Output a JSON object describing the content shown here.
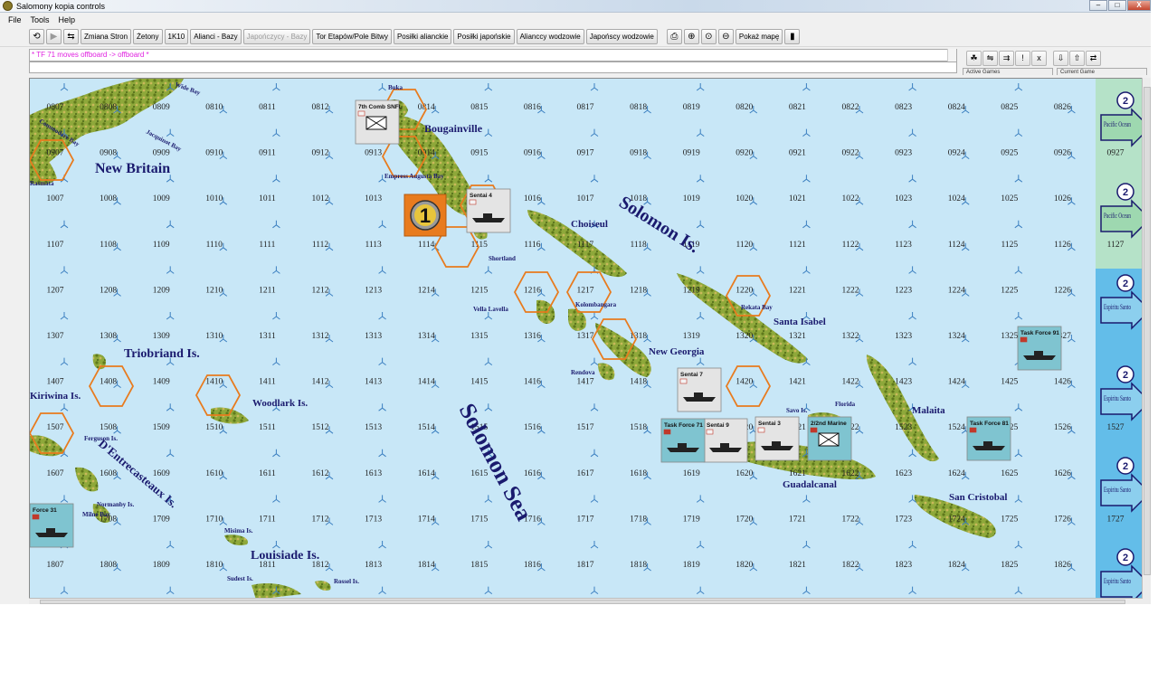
{
  "window": {
    "title": "Salomony kopia controls",
    "minimize": "–",
    "maximize": "□",
    "close": "X"
  },
  "menu": [
    "File",
    "Tools",
    "Help"
  ],
  "toolbar": {
    "buttons": [
      "Zmiana Stron",
      "Żetony",
      "1K10",
      "Alianci - Bazy",
      "Japończycy - Bazy",
      "Tor Etapów/Pole Bitwy",
      "Posiłki alianckie",
      "Posiłki japońskie",
      "Alianccy wodzowie",
      "Japońscy wodzowie"
    ],
    "zoom_label": "Pokaż mapę"
  },
  "chat": {
    "log": "* TF 71 moves offboard -> offboard *"
  },
  "side_tabs": [
    "Active Games",
    "Current Game"
  ],
  "colors": {
    "sea": "#c8e7f7",
    "land": "#8ea83a",
    "hex_outline": "#e87b1e",
    "label": "#1a1a6e"
  },
  "map": {
    "hex_rows": [
      {
        "row": "08",
        "cols": [
          "0807",
          "0808",
          "0809",
          "0810",
          "0811",
          "0812",
          "0813",
          "0814",
          "0815",
          "0816",
          "0817",
          "0818",
          "0819",
          "0820",
          "0821",
          "0822",
          "0823",
          "0824",
          "0825",
          "0826"
        ]
      },
      {
        "row": "09",
        "cols": [
          "0907",
          "0908",
          "0909",
          "0910",
          "0911",
          "0912",
          "0913",
          "0914",
          "0915",
          "0916",
          "0917",
          "0918",
          "0919",
          "0920",
          "0921",
          "0922",
          "0923",
          "0924",
          "0925",
          "0926",
          "0927"
        ]
      },
      {
        "row": "10",
        "cols": [
          "1007",
          "1008",
          "1009",
          "1010",
          "1011",
          "1012",
          "1013",
          "1014",
          "1015",
          "1016",
          "1017",
          "1018",
          "1019",
          "1020",
          "1021",
          "1022",
          "1023",
          "1024",
          "1025",
          "1026"
        ]
      },
      {
        "row": "11",
        "cols": [
          "1107",
          "1108",
          "1109",
          "1110",
          "1111",
          "1112",
          "1113",
          "1114",
          "1115",
          "1116",
          "1117",
          "1118",
          "1119",
          "1120",
          "1121",
          "1122",
          "1123",
          "1124",
          "1125",
          "1126",
          "1127"
        ]
      },
      {
        "row": "12",
        "cols": [
          "1207",
          "1208",
          "1209",
          "1210",
          "1211",
          "1212",
          "1213",
          "1214",
          "1215",
          "1216",
          "1217",
          "1218",
          "1219",
          "1220",
          "1221",
          "1222",
          "1223",
          "1224",
          "1225",
          "1226"
        ]
      },
      {
        "row": "13",
        "cols": [
          "1307",
          "1308",
          "1309",
          "1310",
          "1311",
          "1312",
          "1313",
          "1314",
          "1315",
          "1316",
          "1317",
          "1318",
          "1319",
          "1320",
          "1321",
          "1322",
          "1323",
          "1324",
          "1325",
          "1327"
        ]
      },
      {
        "row": "14",
        "cols": [
          "1407",
          "1408",
          "1409",
          "1410",
          "1411",
          "1412",
          "1413",
          "1414",
          "1415",
          "1416",
          "1417",
          "1418",
          "1419",
          "1420",
          "1421",
          "1422",
          "1423",
          "1424",
          "1425",
          "1426"
        ]
      },
      {
        "row": "15",
        "cols": [
          "1507",
          "1508",
          "1509",
          "1510",
          "1511",
          "1512",
          "1513",
          "1514",
          "1515",
          "1516",
          "1517",
          "1518",
          "1519",
          "1520",
          "1521",
          "1522",
          "1523",
          "1524",
          "1525",
          "1526",
          "1527"
        ]
      },
      {
        "row": "16",
        "cols": [
          "1607",
          "1608",
          "1609",
          "1610",
          "1611",
          "1612",
          "1613",
          "1614",
          "1615",
          "1616",
          "1617",
          "1618",
          "1619",
          "1620",
          "1621",
          "1622",
          "1623",
          "1624",
          "1625",
          "1626"
        ]
      },
      {
        "row": "17",
        "cols": [
          "1707",
          "1708",
          "1709",
          "1710",
          "1711",
          "1712",
          "1713",
          "1714",
          "1715",
          "1716",
          "1717",
          "1718",
          "1719",
          "1720",
          "1721",
          "1722",
          "1723",
          "1724",
          "1725",
          "1726",
          "1727"
        ]
      },
      {
        "row": "18",
        "cols": [
          "1807",
          "1808",
          "1809",
          "1810",
          "1811",
          "1812",
          "1813",
          "1814",
          "1815",
          "1816",
          "1817",
          "1818",
          "1819",
          "1820",
          "1821",
          "1822",
          "1823",
          "1824",
          "1825",
          "1826"
        ]
      }
    ],
    "big_labels": [
      "New Britain",
      "Bougainville",
      "Choiseul",
      "Solomon Is.",
      "Santa Isabel",
      "New Georgia",
      "Triobriand Is.",
      "Woodlark Is.",
      "Kiriwina Is.",
      "D'Entrecasteaux Is.",
      "Louisiade Is.",
      "Solomon Sea",
      "Guadalcanal",
      "Malaita",
      "San Cristobal"
    ],
    "small_labels": [
      "Commodore Bay",
      "Wide Bay",
      "Jacquinot Bay",
      "Buka",
      "Empress Augusta Bay",
      "Shortland",
      "Vella Lavella",
      "Kolombangara",
      "Rendova",
      "Rekata Bay",
      "Savo Is.",
      "Florida",
      "Ferguson Is.",
      "Normanby Is.",
      "Milne Bay",
      "Misima Is.",
      "Sudest Is.",
      "Rossel Is.",
      "Rasmata"
    ],
    "units": [
      {
        "name": "7th Comb SNFL",
        "side": "japanese"
      },
      {
        "name": "Sentai 4",
        "side": "japanese"
      },
      {
        "name": "Sentai 7",
        "side": "japanese"
      },
      {
        "name": "Sentai 9",
        "side": "japanese"
      },
      {
        "name": "Sentai 3",
        "side": "japanese"
      },
      {
        "name": "Task Force 71",
        "side": "allied"
      },
      {
        "name": "Task Force 91",
        "side": "allied"
      },
      {
        "name": "Task Force 81",
        "side": "allied"
      },
      {
        "name": "Force 31",
        "side": "allied"
      },
      {
        "name": "2/2nd Marine",
        "side": "allied"
      }
    ],
    "turn_marker": "1",
    "edge_boxes": [
      {
        "number": "2",
        "label": "Pacific Ocean"
      },
      {
        "number": "2",
        "label": "Pacific Ocean"
      },
      {
        "number": "2",
        "label": "Espiritu Santo"
      },
      {
        "number": "2",
        "label": "Espiritu Santo"
      },
      {
        "number": "2",
        "label": "Espiritu Santo"
      },
      {
        "number": "2",
        "label": "Espiritu Santo"
      }
    ]
  }
}
